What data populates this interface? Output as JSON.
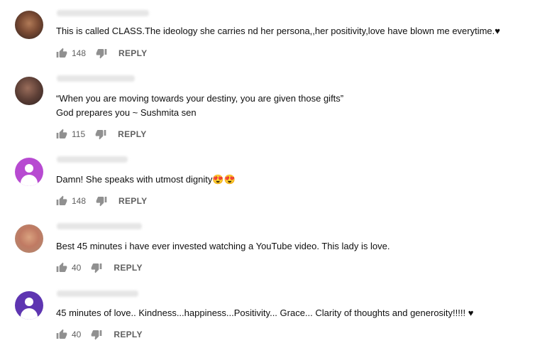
{
  "comments": [
    {
      "avatar": "photo1",
      "lines": [
        "This is called CLASS.The ideology she carries nd her persona,,her positivity,love have blown me everytime.♥"
      ],
      "likes": "148",
      "reply": "REPLY"
    },
    {
      "avatar": "photo2",
      "lines": [
        "“When you are moving towards your destiny, you are given those gifts”",
        "God prepares you ~ Sushmita sen"
      ],
      "likes": "115",
      "reply": "REPLY"
    },
    {
      "avatar": "default",
      "avatar_color": "#b74ad1",
      "lines": [
        "Damn! She speaks with utmost dignity😍😍"
      ],
      "likes": "148",
      "reply": "REPLY"
    },
    {
      "avatar": "photo3",
      "lines": [
        "Best 45 minutes i have ever invested watching a YouTube video.  This lady is love."
      ],
      "likes": "40",
      "reply": "REPLY"
    },
    {
      "avatar": "default",
      "avatar_color": "#5e35b1",
      "lines": [
        "45 minutes of love.. Kindness...happiness...Positivity... Grace... Clarity of thoughts and generosity!!!!!  ♥"
      ],
      "likes": "40",
      "reply": "REPLY"
    }
  ],
  "icons": {
    "like": "thumb-up-icon",
    "dislike": "thumb-down-icon"
  }
}
